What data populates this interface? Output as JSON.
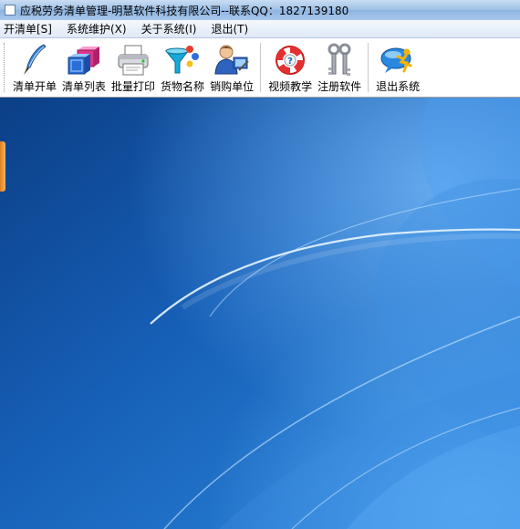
{
  "window": {
    "title": "应税劳务清单管理-明慧软件科技有限公司--联系QQ：1827139180"
  },
  "menubar": {
    "items": [
      {
        "label": "开清单[S]"
      },
      {
        "label": "系统维护(X)"
      },
      {
        "label": "关于系统(I)"
      },
      {
        "label": "退出(T)"
      }
    ]
  },
  "toolbar": {
    "buttons": [
      {
        "label": "清单开单",
        "icon": "feather-pen-icon"
      },
      {
        "label": "清单列表",
        "icon": "cubes-icon"
      },
      {
        "label": "批量打印",
        "icon": "printer-icon"
      },
      {
        "label": "货物名称",
        "icon": "funnel-icon"
      },
      {
        "label": "销购单位",
        "icon": "user-icon"
      },
      {
        "label": "视频教学",
        "icon": "lifebuoy-icon"
      },
      {
        "label": "注册软件",
        "icon": "keys-icon"
      },
      {
        "label": "退出系统",
        "icon": "exit-running-man-icon"
      }
    ]
  },
  "colors": {
    "desktop_dark": "#0f4c9c",
    "desktop_light": "#3a8bd8"
  }
}
